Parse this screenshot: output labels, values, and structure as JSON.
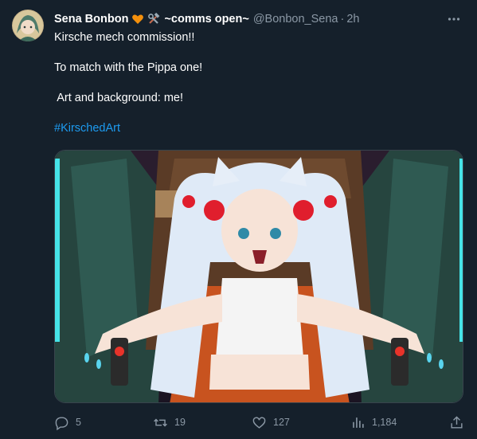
{
  "tweet": {
    "display_name": "Sena Bonbon",
    "name_suffix": "~comms open~",
    "handle": "@Bonbon_Sena",
    "separator": "·",
    "time": "2h",
    "lines": [
      "Kirsche mech commission!!",
      "",
      "To match with the Pippa one!",
      "",
      " Art and background: me!",
      ""
    ],
    "hashtag": "#KirschedArt",
    "emoji": [
      "orange-heart",
      "hammer-and-wrench"
    ]
  },
  "actions": {
    "replies": "5",
    "retweets": "19",
    "likes": "127",
    "views": "1,184"
  },
  "colors": {
    "background": "#15202b",
    "text_secondary": "#8b98a5",
    "link": "#1d9bf0",
    "border": "#38444d"
  }
}
